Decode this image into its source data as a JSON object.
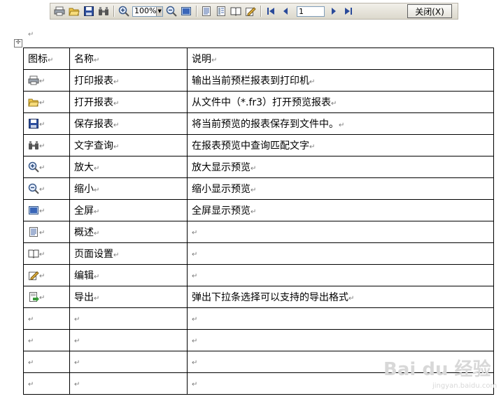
{
  "toolbar": {
    "zoom_value": "100%",
    "page_value": "1",
    "close_label": "关闭(X)"
  },
  "table": {
    "header": [
      "图标",
      "名称",
      "说明"
    ],
    "rows": [
      {
        "icon": "printer-icon",
        "name": "打印报表",
        "desc": "输出当前预栏报表到打印机"
      },
      {
        "icon": "open-folder-icon",
        "name": "打开报表",
        "desc": "从文件中（*.fr3）打开预览报表"
      },
      {
        "icon": "save-icon",
        "name": "保存报表",
        "desc": "将当前预览的报表保存到文件中。"
      },
      {
        "icon": "binoculars-icon",
        "name": "文字查询",
        "desc": "在报表预览中查询匹配文字"
      },
      {
        "icon": "zoom-in-icon",
        "name": "放大",
        "desc": "放大显示预览"
      },
      {
        "icon": "zoom-out-icon",
        "name": "缩小",
        "desc": "缩小显示预览"
      },
      {
        "icon": "fullscreen-icon",
        "name": "全屏",
        "desc": "全屏显示预览"
      },
      {
        "icon": "outline-icon",
        "name": "概述",
        "desc": ""
      },
      {
        "icon": "page-setup-icon",
        "name": "页面设置",
        "desc": ""
      },
      {
        "icon": "edit-icon",
        "name": "编辑",
        "desc": ""
      },
      {
        "icon": "export-icon",
        "name": "导出",
        "desc": "弹出下拉条选择可以支持的导出格式"
      },
      {
        "icon": "",
        "name": "",
        "desc": ""
      },
      {
        "icon": "",
        "name": "",
        "desc": ""
      },
      {
        "icon": "",
        "name": "",
        "desc": ""
      },
      {
        "icon": "",
        "name": "",
        "desc": ""
      }
    ]
  },
  "marks": {
    "para": "↵"
  },
  "watermark": {
    "logo": "Bai du 经验",
    "sub": "jingyan.baidu.com"
  }
}
